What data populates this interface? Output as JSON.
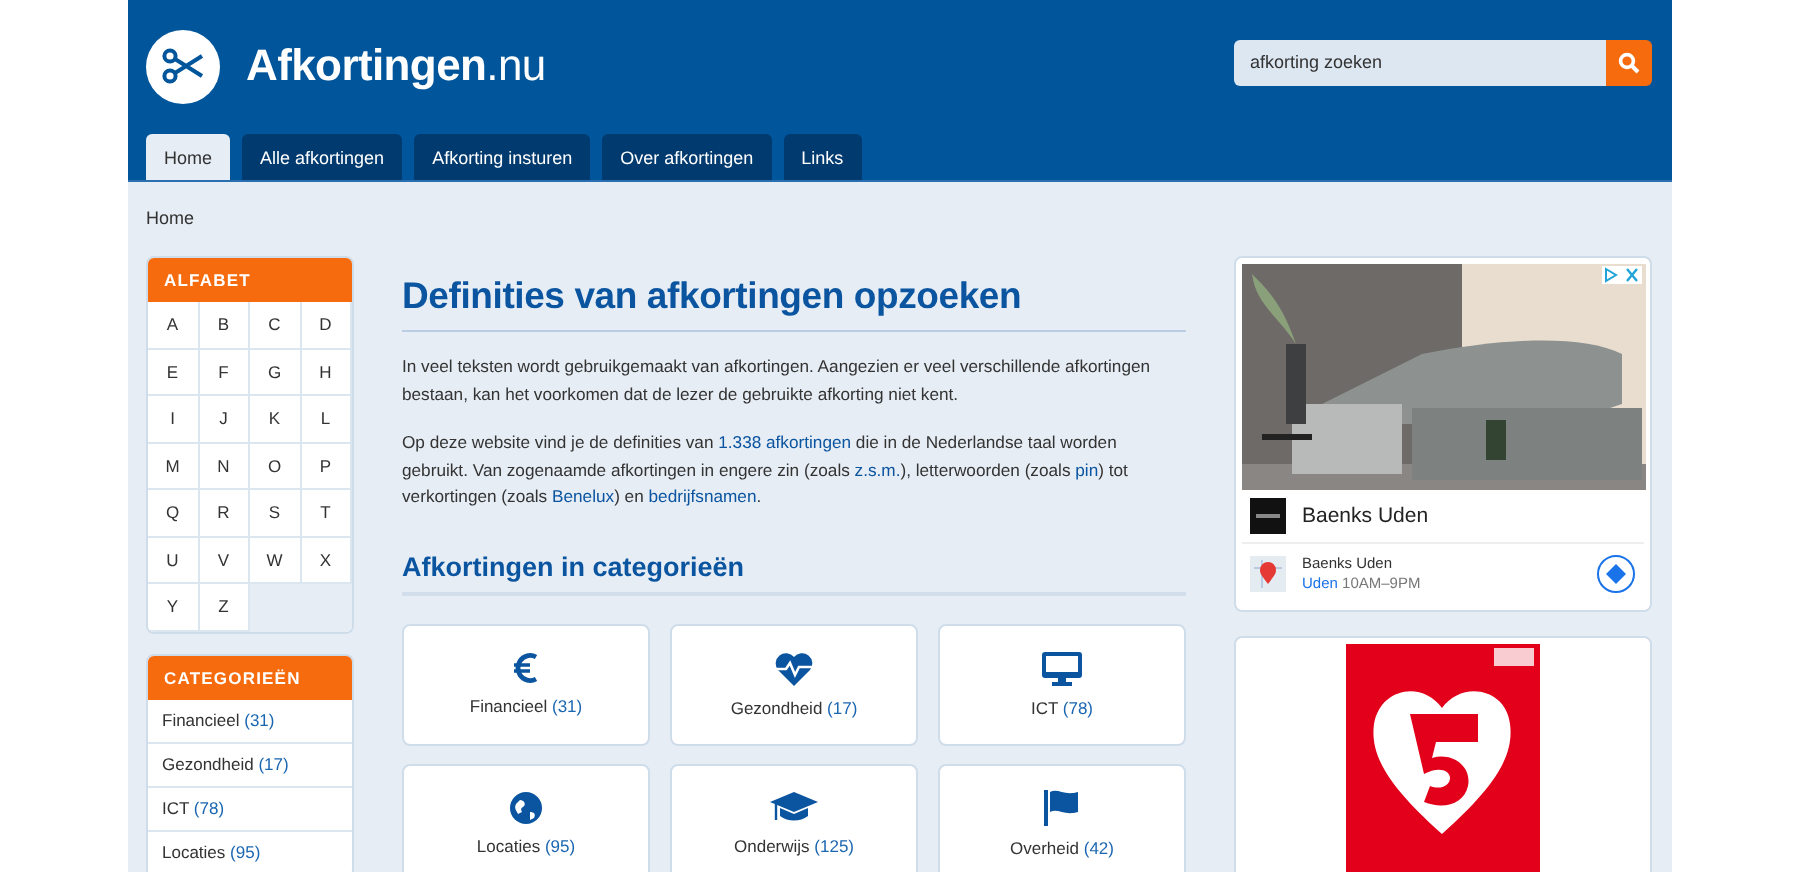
{
  "site": {
    "title": "**Afkortingen**.nu"
  },
  "search": {
    "placeholder": "afkorting zoeken"
  },
  "tabs": [
    {
      "label": "Home",
      "selected": true
    },
    {
      "label": "Alle afkortingen",
      "selected": false
    },
    {
      "label": "Afkorting insturen",
      "selected": false
    },
    {
      "label": "Over afkortingen",
      "selected": false
    },
    {
      "label": "Links",
      "selected": false
    }
  ],
  "breadcrumb": "Home",
  "alphabet": {
    "title": "ALFABET",
    "letters": [
      "A",
      "B",
      "C",
      "D",
      "E",
      "F",
      "G",
      "H",
      "I",
      "J",
      "K",
      "L",
      "M",
      "N",
      "O",
      "P",
      "Q",
      "R",
      "S",
      "T",
      "U",
      "V",
      "W",
      "X",
      "Y",
      "Z"
    ]
  },
  "sidebar_categories": {
    "title": "CATEGORIEËN",
    "items": [
      {
        "label": "Financieel",
        "count": "(31)"
      },
      {
        "label": "Gezondheid",
        "count": "(17)"
      },
      {
        "label": "ICT",
        "count": "(78)"
      },
      {
        "label": "Locaties",
        "count": "(95)"
      }
    ]
  },
  "main": {
    "title": "Definities van afkortingen opzoeken",
    "paragraphs": [
      [
        {
          "text": "In veel teksten wordt gebruikgemaakt van afkortingen. Aangezien er veel verschillende afkortingen bestaan, kan het voorkomen dat de lezer de gebruikte afkorting niet kent."
        }
      ],
      [
        {
          "text": "Op deze website vind je de definities van "
        },
        {
          "link": "1.338 afkortingen"
        },
        {
          "text": " die in de Nederlandse taal worden gebruikt. Van zogenaamde afkortingen in engere zin (zoals "
        },
        {
          "link": "z.s.m."
        },
        {
          "text": "), letterwoorden (zoals "
        },
        {
          "link": "pin"
        },
        {
          "text": ") tot verkortingen (zoals "
        },
        {
          "link": "Benelux"
        },
        {
          "text": ") en "
        },
        {
          "link": "bedrijfsnamen"
        },
        {
          "text": "."
        }
      ]
    ],
    "categories_title": "Afkortingen in categorieën",
    "categories": [
      {
        "kind": "euro",
        "label": "Financieel",
        "count": "(31)"
      },
      {
        "kind": "heart",
        "label": "Gezondheid",
        "count": "(17)"
      },
      {
        "kind": "monitor",
        "label": "ICT",
        "count": "(78)"
      },
      {
        "kind": "globe",
        "label": "Locaties",
        "count": "(95)"
      },
      {
        "kind": "cap",
        "label": "Onderwijs",
        "count": "(125)"
      },
      {
        "kind": "flag",
        "label": "Overheid",
        "count": "(42)"
      }
    ]
  },
  "ads": [
    {
      "kind": "store",
      "name": "Baenks Uden",
      "place_name": "Baenks Uden",
      "place_city": "Uden",
      "hours": "10AM–9PM"
    },
    {
      "kind": "banner"
    }
  ]
}
